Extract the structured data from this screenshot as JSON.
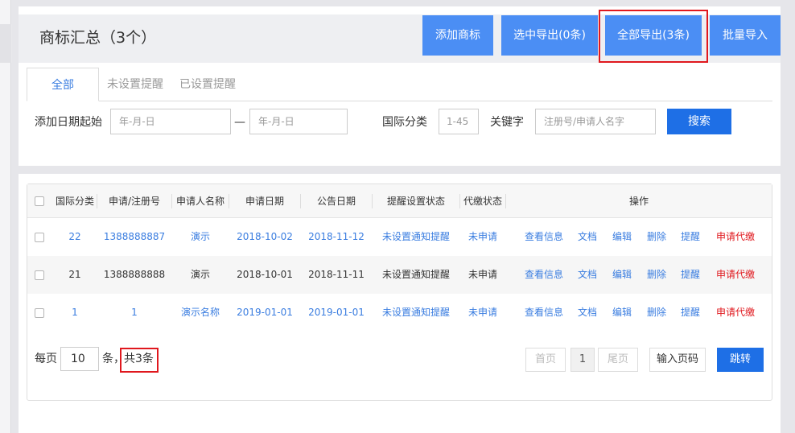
{
  "header": {
    "title": "商标汇总（3个）",
    "add_btn": "添加商标",
    "export_selected_btn": "选中导出(0条)",
    "export_all_btn": "全部导出(3条)",
    "batch_import_btn": "批量导入"
  },
  "tabs": [
    {
      "label": "全部",
      "active": true
    },
    {
      "label": "未设置提醒",
      "active": false
    },
    {
      "label": "已设置提醒",
      "active": false
    }
  ],
  "filters": {
    "date_label": "添加日期起始",
    "date_from_placeholder": "年-月-日",
    "date_sep": "—",
    "date_to_placeholder": "年-月-日",
    "class_label": "国际分类",
    "class_placeholder": "1-45",
    "keyword_label": "关键字",
    "keyword_placeholder": "注册号/申请人名字",
    "search_btn": "搜索"
  },
  "table": {
    "columns": [
      "国际分类",
      "申请/注册号",
      "申请人名称",
      "申请日期",
      "公告日期",
      "提醒设置状态",
      "代缴状态",
      "操作"
    ],
    "rows": [
      {
        "cls": "22",
        "no": "1388888887",
        "applicant": "演示",
        "apply_date": "2018-10-02",
        "pub_date": "2018-11-12",
        "remind": "未设置通知提醒",
        "pay": "未申请",
        "style": "link"
      },
      {
        "cls": "21",
        "no": "1388888888",
        "applicant": "演示",
        "apply_date": "2018-10-01",
        "pub_date": "2018-11-11",
        "remind": "未设置通知提醒",
        "pay": "未申请",
        "style": "plain"
      },
      {
        "cls": "1",
        "no": "1",
        "applicant": "演示名称",
        "apply_date": "2019-01-01",
        "pub_date": "2019-01-01",
        "remind": "未设置通知提醒",
        "pay": "未申请",
        "style": "link"
      }
    ],
    "actions": {
      "view": "查看信息",
      "doc": "文档",
      "edit": "编辑",
      "delete": "删除",
      "remind": "提醒",
      "pay": "申请代缴"
    }
  },
  "pager": {
    "per_page_label": "每页",
    "per_page_value": "10",
    "unit_label": "条，",
    "total_label": "共3条",
    "first_btn": "首页",
    "current_page": "1",
    "last_btn": "尾页",
    "page_input_placeholder": "输入页码",
    "jump_btn": "跳转"
  }
}
